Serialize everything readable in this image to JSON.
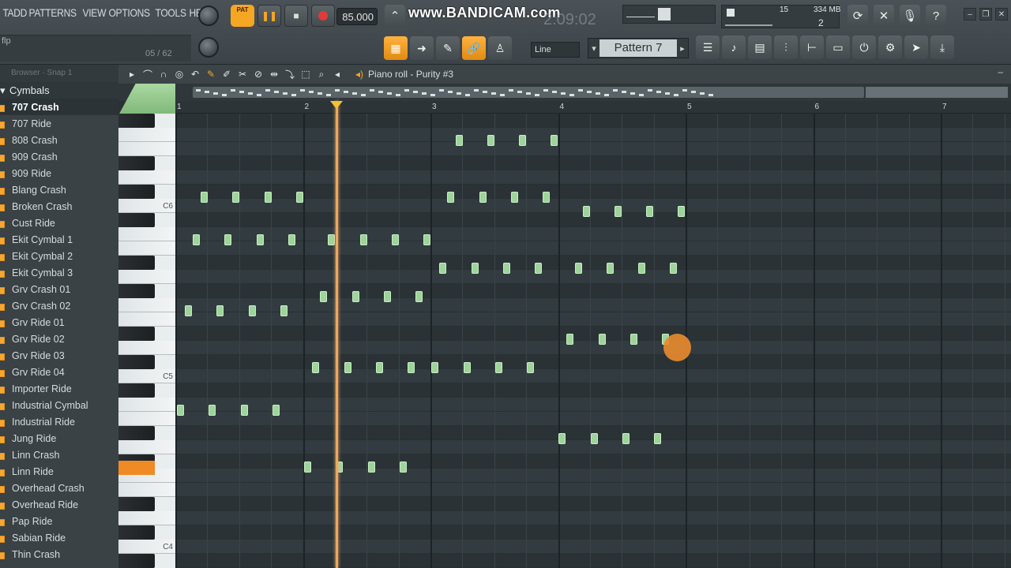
{
  "menu": [
    "T",
    "ADD",
    "PATTERNS",
    "VIEW",
    "OPTIONS",
    "TOOLS",
    "HELP"
  ],
  "hint": {
    "text": "flp",
    "counter": "05 / 62"
  },
  "transport": {
    "pat_label": "PAT",
    "tempo": "85.000"
  },
  "watermark": "www.BANDICAM.com",
  "time_ghost": "2:09:02",
  "meters": {
    "cpu": "334 MB",
    "voices": "2",
    "mem": "15"
  },
  "pattern": {
    "line_mode": "Line",
    "name": "Pattern 7"
  },
  "browser": {
    "header": "Browser · Snap 1",
    "folder": "Cymbals",
    "items": [
      "707 Crash",
      "707 Ride",
      "808 Crash",
      "909 Crash",
      "909 Ride",
      "Blang Crash",
      "Broken Crash",
      "Cust Ride",
      "Ekit Cymbal 1",
      "Ekit Cymbal 2",
      "Ekit Cymbal 3",
      "Grv Crash 01",
      "Grv Crash 02",
      "Grv Ride 01",
      "Grv Ride 02",
      "Grv Ride 03",
      "Grv Ride 04",
      "Importer Ride",
      "Industrial Cymbal",
      "Industrial Ride",
      "Jung Ride",
      "Linn Crash",
      "Linn Ride",
      "Overhead Crash",
      "Overhead Ride",
      "Pap Ride",
      "Sabian Ride",
      "Thin Crash"
    ],
    "active_index": 0
  },
  "piano_roll": {
    "title": "Piano roll - Purity #3",
    "bars": [
      "1",
      "2",
      "3",
      "4",
      "5",
      "6",
      "7"
    ],
    "key_labels": [
      "C6",
      "C5",
      "C4"
    ]
  },
  "colors": {
    "accent": "#f5a623",
    "note": "#9fd39c",
    "playhead": "#f0a65d",
    "record": "#e03a3a"
  },
  "icons": [
    "play-icon",
    "stop-icon",
    "record-icon",
    "pencil-icon",
    "paint-icon",
    "delete-icon",
    "mute-icon",
    "slice-icon",
    "select-icon",
    "zoom-icon",
    "speaker-icon",
    "gear-icon",
    "mic-icon",
    "help-icon",
    "minimize-icon",
    "maximize-icon",
    "close-icon"
  ]
}
